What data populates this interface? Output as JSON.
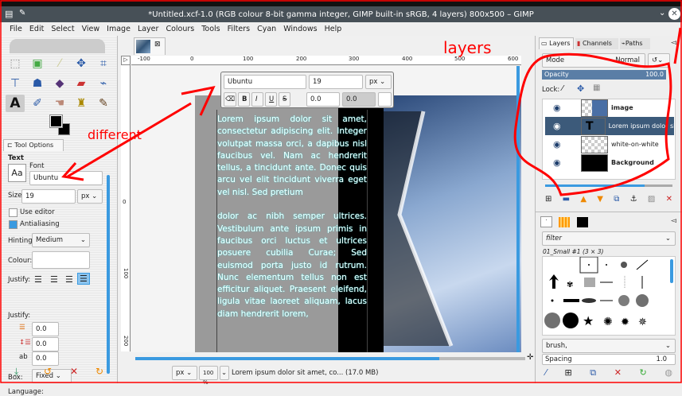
{
  "window": {
    "title": "*Untitled.xcf-1.0 (RGB colour 8-bit gamma integer, GIMP built-in sRGB, 4 layers) 800x500 – GIMP"
  },
  "menu": [
    "File",
    "Edit",
    "Select",
    "View",
    "Image",
    "Layer",
    "Colours",
    "Tools",
    "Filters",
    "Cyan",
    "Windows",
    "Help"
  ],
  "tool_options": {
    "tab": "Tool Options",
    "section": "Text",
    "font_label": "Font",
    "font": "Ubuntu",
    "size_label": "Size:",
    "size": "19",
    "unit": "px",
    "use_editor": "Use editor",
    "antialiasing": "Antialiasing",
    "hinting_label": "Hinting:",
    "hinting": "Medium",
    "colour_label": "Colour:",
    "justify_label": "Justify:",
    "indent": "0.0",
    "line_spacing": "0.0",
    "letter_spacing": "0.0",
    "box_label": "Box:",
    "box": "Fixed",
    "language_label": "Language:"
  },
  "text_toolbar": {
    "font": "Ubuntu",
    "size": "19",
    "unit": "px",
    "bold": "B",
    "italic": "I",
    "underline": "U",
    "strike": "S",
    "baseline": "0.0",
    "kerning": "0.0"
  },
  "rulers": {
    "h": [
      "-100",
      "0",
      "100",
      "200",
      "300",
      "400",
      "500",
      "600"
    ],
    "v": [
      "0",
      "100",
      "200"
    ]
  },
  "canvas_text": {
    "p1": "Lorem ipsum dolor sit amet, consectetur adipiscing elit. Integer volutpat massa orci, a dapibus nisl faucibus vel. Nam ac hendrerit tellus, a tincidunt ante. Donec quis arcu vel elit tincidunt viverra eget vel nisl. Sed pretium",
    "p2": "dolor ac nibh semper ultrices. Vestibulum ante ipsum primis in faucibus orci luctus et ultrices posuere cubilia Curae; Sed euismod porta justo id rutrum. Nunc elementum tellus non est efficitur aliquet. Praesent eleifend, ligula vitae laoreet aliquam, lacus diam hendrerit lorem,"
  },
  "statusbar": {
    "unit": "px",
    "zoom": "100 %",
    "message": "Lorem ipsum dolor sit amet, co... (17.0 MB)"
  },
  "layers_panel": {
    "tabs": [
      "Layers",
      "Channels",
      "Paths"
    ],
    "mode_label": "Mode",
    "mode": "Normal",
    "opacity_label": "Opacity",
    "opacity": "100.0",
    "lock_label": "Lock:",
    "layers": [
      {
        "name": "image"
      },
      {
        "name": "Lorem ipsum dolor sit a",
        "selected": true
      },
      {
        "name": "white-on-white"
      },
      {
        "name": "Background"
      }
    ]
  },
  "brushes_panel": {
    "filter": "filter",
    "brush_name": "01_Small #1 (3 × 3)",
    "tag": "brush,",
    "spacing_label": "Spacing",
    "spacing": "1.0"
  },
  "annotations": {
    "different": "different",
    "layers": "layers",
    "color": "#ff0000"
  }
}
